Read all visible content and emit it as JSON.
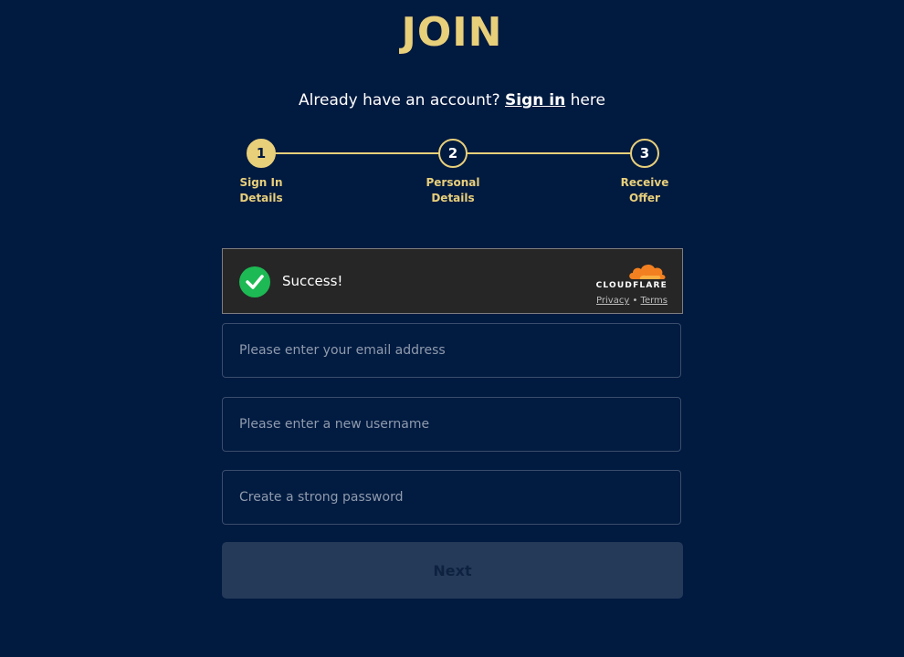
{
  "page": {
    "title": "JOIN",
    "signin_prefix": "Already have an account?",
    "signin_link": "Sign in",
    "signin_suffix": "here"
  },
  "stepper": {
    "steps": [
      {
        "number": "1",
        "label": "Sign In\nDetails",
        "active": true
      },
      {
        "number": "2",
        "label": "Personal\nDetails",
        "active": false
      },
      {
        "number": "3",
        "label": "Receive\nOffer",
        "active": false
      }
    ]
  },
  "captcha": {
    "status": "Success!",
    "brand": "CLOUDFLARE",
    "privacy_link": "Privacy",
    "separator": "•",
    "terms_link": "Terms"
  },
  "form": {
    "email_placeholder": "Please enter your email address",
    "username_placeholder": "Please enter a new username",
    "password_placeholder": "Create a strong password",
    "next_label": "Next"
  },
  "colors": {
    "background": "#011a40",
    "accent": "#e8cf7a",
    "success": "#1db954",
    "cloudflare_orange": "#f38020"
  }
}
